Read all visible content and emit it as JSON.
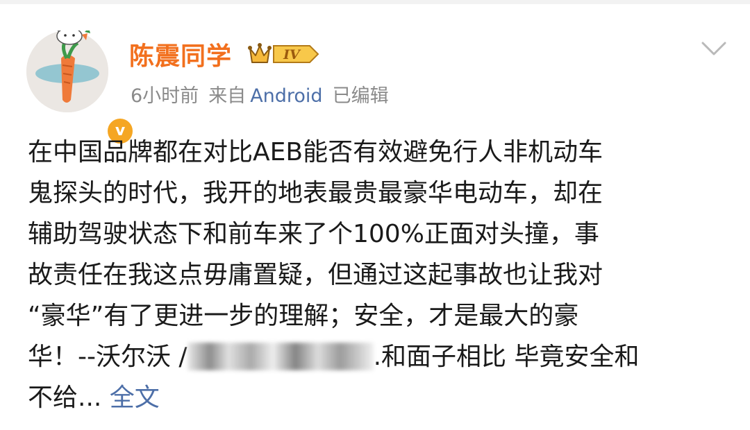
{
  "post": {
    "username": "陈震同学",
    "vip_level": "IV",
    "verified_mark": "v",
    "time": "6小时前",
    "source_prefix": "来自",
    "source": "Android",
    "edited": "已编辑",
    "content_lines": [
      "在中国品牌都在对比AEB能否有效避免行人非机动车",
      "鬼探头的时代，我开的地表最贵最豪华电动车，却在",
      "辅助驾驶状态下和前车来了个100%正面对头撞，事",
      "故责任在我这点毋庸置疑，但通过这起事故也让我对",
      "“豪华”有了更进一步的理解；安全，才是最大的豪"
    ],
    "line6_prefix": "华！--沃尔沃 /",
    "line6_suffix": ".和面子相比 毕竟安全和",
    "line7_text": "不给...",
    "full_text_link": "全文"
  },
  "icons": {
    "avatar": "bunny-carrot-avatar",
    "vip": "crown-icon",
    "menu": "chevron-down-icon"
  },
  "colors": {
    "username": "#f2701e",
    "link": "#4d6fa8",
    "meta": "#8a8a8a",
    "text": "#1a1a1a",
    "verified": "#f5a623"
  }
}
